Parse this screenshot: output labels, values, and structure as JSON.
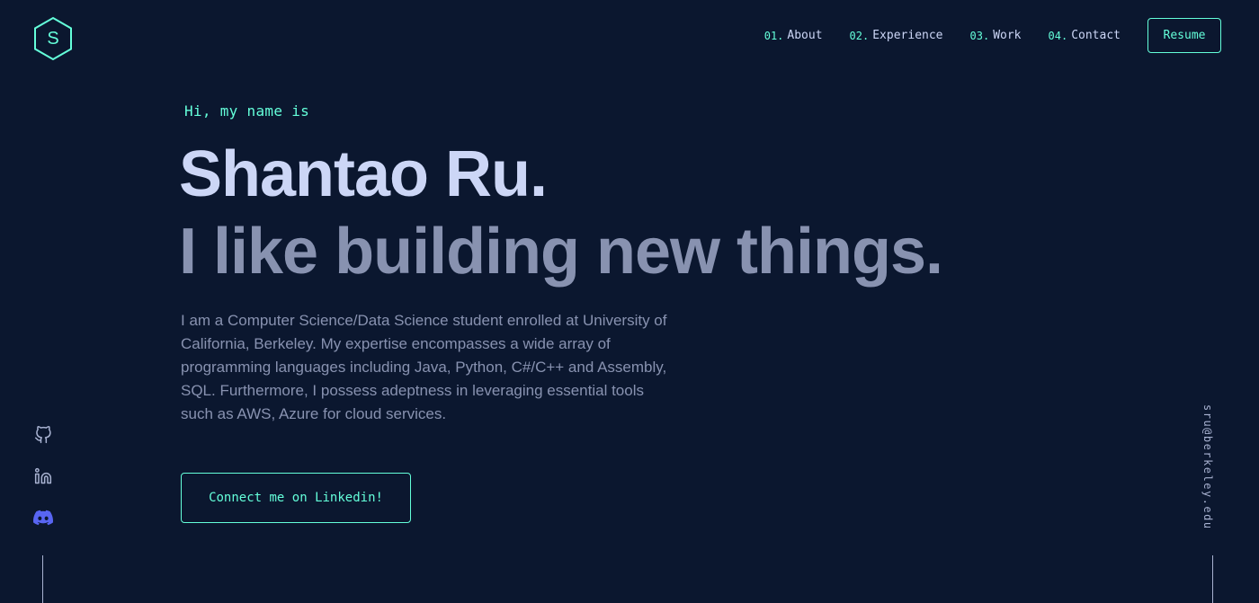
{
  "header": {
    "logo_letter": "S",
    "nav": [
      {
        "num": "01.",
        "label": "About"
      },
      {
        "num": "02.",
        "label": "Experience"
      },
      {
        "num": "03.",
        "label": "Work"
      },
      {
        "num": "04.",
        "label": "Contact"
      }
    ],
    "resume_label": "Resume"
  },
  "hero": {
    "greeting": "Hi, my name is",
    "name": "Shantao Ru.",
    "tagline": "I like building new things.",
    "bio": "I am a Computer Science/Data Science student enrolled at University of California, Berkeley. My expertise encompasses a wide array of programming languages including Java, Python, C#/C++ and Assembly, SQL. Furthermore, I possess adeptness in leveraging essential tools such as AWS, Azure for cloud services.",
    "cta_label": "Connect me on Linkedin!"
  },
  "social": {
    "icons": [
      "github-icon",
      "linkedin-icon",
      "discord-icon"
    ]
  },
  "email": "sru@berkeley.edu",
  "colors": {
    "background": "#0b172f",
    "accent": "#64ffda",
    "heading": "#ccd6f6",
    "text": "#8892b0",
    "discord": "#5865f2"
  }
}
